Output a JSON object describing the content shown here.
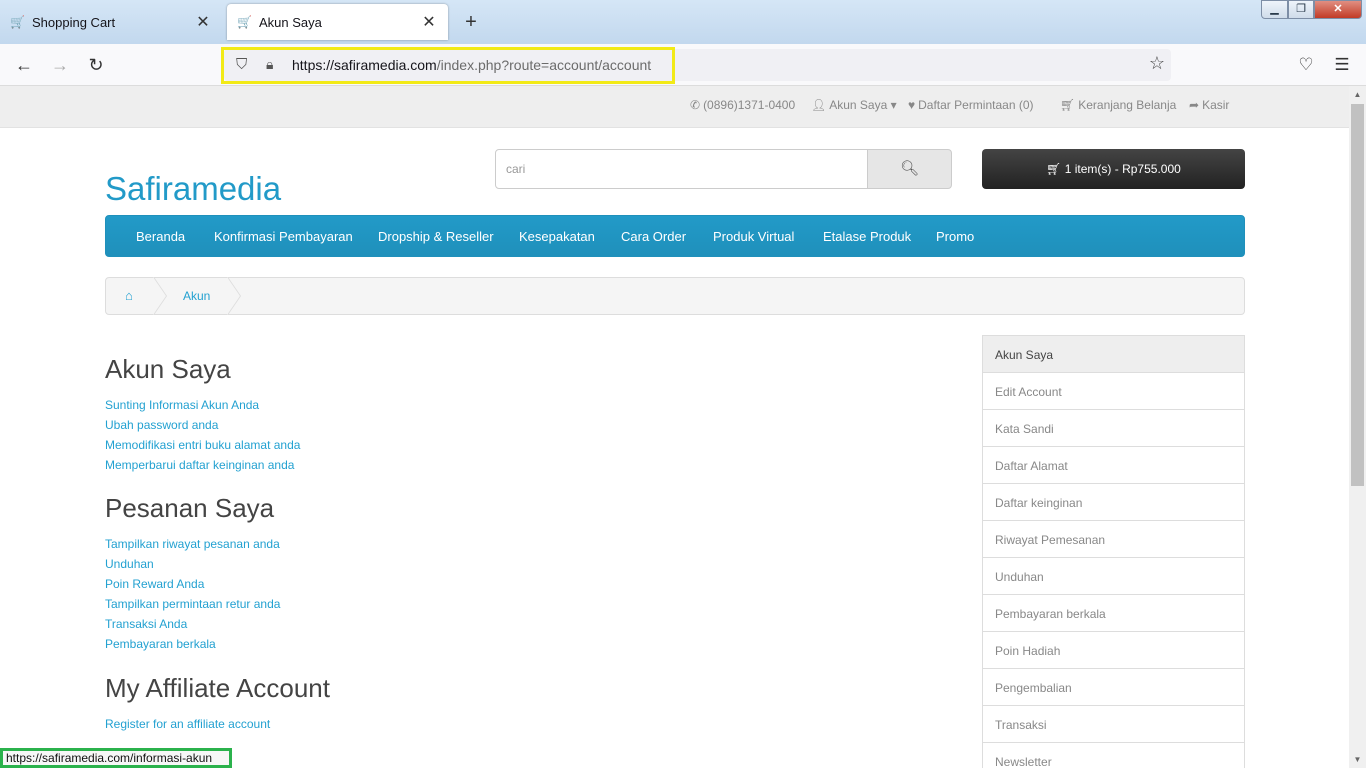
{
  "browser": {
    "tabs": [
      {
        "title": "Shopping Cart",
        "close": "✕"
      },
      {
        "title": "Akun Saya",
        "close": "✕"
      }
    ],
    "new_tab": "+",
    "url_host": "https://safiramedia.com",
    "url_path": "/index.php?route=account/account",
    "status_url": "https://safiramedia.com/informasi-akun",
    "icons": [
      "back-icon",
      "forward-icon",
      "reload-icon",
      "shield-icon",
      "lock-icon",
      "bookmark-star-icon",
      "pocket-icon",
      "menu-icon"
    ]
  },
  "topbar": {
    "phone": "(0896)1371-0400",
    "account": "Akun Saya",
    "wishlist": "Daftar Permintaan (0)",
    "cart": "Keranjang Belanja",
    "checkout": "Kasir"
  },
  "header": {
    "logo": "Safiramedia",
    "search_placeholder": "cari",
    "cart_button": "1 item(s) - Rp755.000"
  },
  "menu": [
    "Beranda",
    "Konfirmasi Pembayaran",
    "Dropship & Reseller",
    "Kesepakatan",
    "Cara Order",
    "Produk Virtual",
    "Etalase Produk",
    "Promo"
  ],
  "breadcrumb": {
    "current": "Akun"
  },
  "sections": {
    "account": {
      "title": "Akun Saya",
      "links": [
        "Sunting Informasi Akun Anda",
        "Ubah password anda",
        "Memodifikasi entri buku alamat anda",
        "Memperbarui daftar keinginan anda"
      ]
    },
    "orders": {
      "title": "Pesanan Saya",
      "links": [
        "Tampilkan riwayat pesanan anda",
        "Unduhan",
        "Poin Reward Anda",
        "Tampilkan permintaan retur anda",
        "Transaksi Anda",
        "Pembayaran berkala"
      ]
    },
    "affiliate": {
      "title": "My Affiliate Account",
      "links": [
        "Register for an affiliate account"
      ]
    }
  },
  "sidebar": [
    "Akun Saya",
    "Edit Account",
    "Kata Sandi",
    "Daftar Alamat",
    "Daftar keinginan",
    "Riwayat Pemesanan",
    "Unduhan",
    "Pembayaran berkala",
    "Poin Hadiah",
    "Pengembalian",
    "Transaksi",
    "Newsletter"
  ],
  "colors": {
    "brand": "#229ac8",
    "link": "#23a1d1",
    "url_highlight": "#f2ea16",
    "status_highlight": "#2bb24c"
  }
}
